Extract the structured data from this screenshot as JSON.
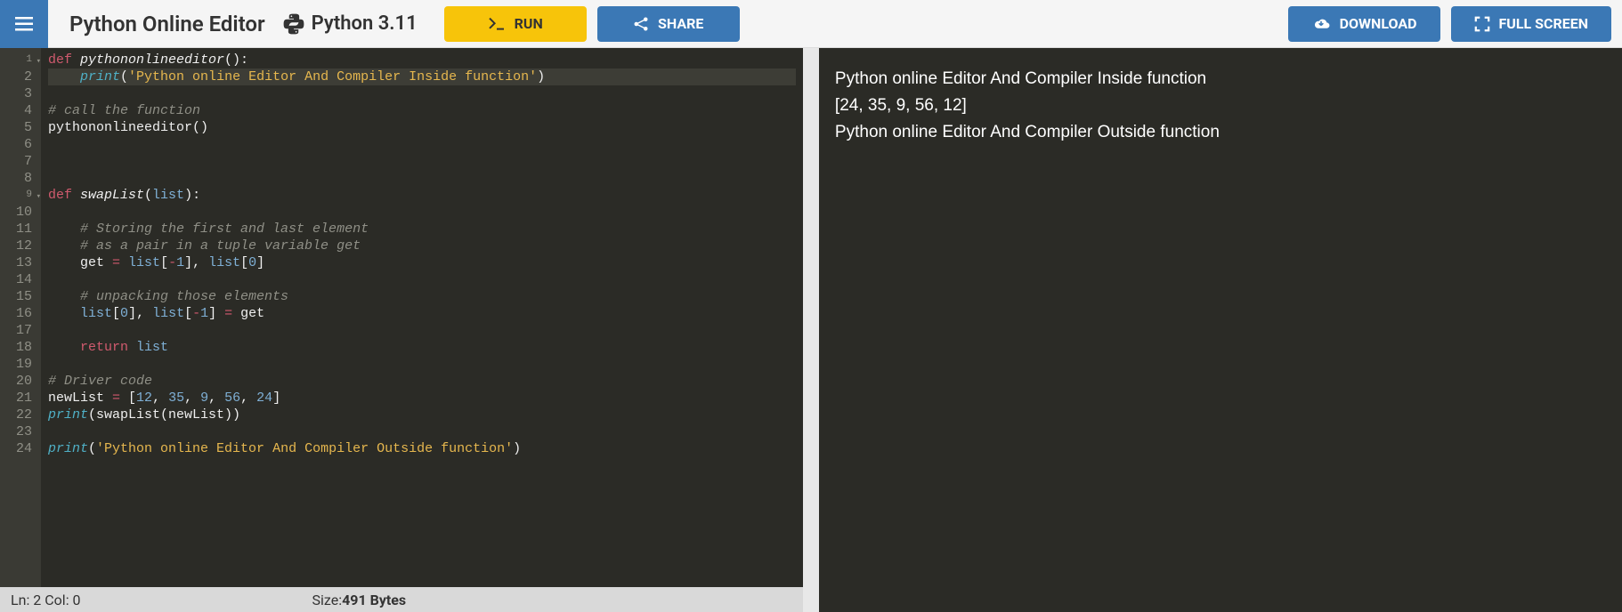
{
  "toolbar": {
    "title": "Python Online Editor",
    "language": "Python 3.11",
    "run_label": "RUN",
    "share_label": "SHARE",
    "download_label": "DOWNLOAD",
    "fullscreen_label": "FULL SCREEN"
  },
  "editor": {
    "line_numbers": [
      "1",
      "2",
      "3",
      "4",
      "5",
      "6",
      "7",
      "8",
      "9",
      "10",
      "11",
      "12",
      "13",
      "14",
      "15",
      "16",
      "17",
      "18",
      "19",
      "20",
      "21",
      "22",
      "23",
      "24"
    ],
    "fold_lines": [
      1,
      9
    ],
    "active_line": 2,
    "lines": [
      [
        {
          "t": "def ",
          "c": "kw"
        },
        {
          "t": "pythononlineeditor",
          "c": "fn"
        },
        {
          "t": "():",
          "c": "punct"
        }
      ],
      [
        {
          "t": "    ",
          "c": "id"
        },
        {
          "t": "print",
          "c": "call"
        },
        {
          "t": "(",
          "c": "punct"
        },
        {
          "t": "'Python online Editor And Compiler Inside function'",
          "c": "str"
        },
        {
          "t": ")",
          "c": "punct"
        }
      ],
      [],
      [
        {
          "t": "# call the function",
          "c": "cm"
        }
      ],
      [
        {
          "t": "pythononlineeditor",
          "c": "id"
        },
        {
          "t": "()",
          "c": "punct"
        }
      ],
      [],
      [],
      [],
      [
        {
          "t": "def ",
          "c": "kw"
        },
        {
          "t": "swapList",
          "c": "fn"
        },
        {
          "t": "(",
          "c": "punct"
        },
        {
          "t": "list",
          "c": "builtin"
        },
        {
          "t": "):",
          "c": "punct"
        }
      ],
      [],
      [
        {
          "t": "    ",
          "c": "id"
        },
        {
          "t": "# Storing the first and last element",
          "c": "cm"
        }
      ],
      [
        {
          "t": "    ",
          "c": "id"
        },
        {
          "t": "# as a pair in a tuple variable get",
          "c": "cm"
        }
      ],
      [
        {
          "t": "    get ",
          "c": "id"
        },
        {
          "t": "=",
          "c": "op"
        },
        {
          "t": " ",
          "c": "id"
        },
        {
          "t": "list",
          "c": "builtin"
        },
        {
          "t": "[",
          "c": "punct"
        },
        {
          "t": "-",
          "c": "op"
        },
        {
          "t": "1",
          "c": "num"
        },
        {
          "t": "], ",
          "c": "punct"
        },
        {
          "t": "list",
          "c": "builtin"
        },
        {
          "t": "[",
          "c": "punct"
        },
        {
          "t": "0",
          "c": "num"
        },
        {
          "t": "]",
          "c": "punct"
        }
      ],
      [],
      [
        {
          "t": "    ",
          "c": "id"
        },
        {
          "t": "# unpacking those elements",
          "c": "cm"
        }
      ],
      [
        {
          "t": "    ",
          "c": "id"
        },
        {
          "t": "list",
          "c": "builtin"
        },
        {
          "t": "[",
          "c": "punct"
        },
        {
          "t": "0",
          "c": "num"
        },
        {
          "t": "], ",
          "c": "punct"
        },
        {
          "t": "list",
          "c": "builtin"
        },
        {
          "t": "[",
          "c": "punct"
        },
        {
          "t": "-",
          "c": "op"
        },
        {
          "t": "1",
          "c": "num"
        },
        {
          "t": "] ",
          "c": "punct"
        },
        {
          "t": "=",
          "c": "op"
        },
        {
          "t": " get",
          "c": "id"
        }
      ],
      [],
      [
        {
          "t": "    ",
          "c": "id"
        },
        {
          "t": "return ",
          "c": "kw"
        },
        {
          "t": "list",
          "c": "builtin"
        }
      ],
      [],
      [
        {
          "t": "# Driver code",
          "c": "cm"
        }
      ],
      [
        {
          "t": "newList ",
          "c": "id"
        },
        {
          "t": "=",
          "c": "op"
        },
        {
          "t": " [",
          "c": "punct"
        },
        {
          "t": "12",
          "c": "num"
        },
        {
          "t": ", ",
          "c": "punct"
        },
        {
          "t": "35",
          "c": "num"
        },
        {
          "t": ", ",
          "c": "punct"
        },
        {
          "t": "9",
          "c": "num"
        },
        {
          "t": ", ",
          "c": "punct"
        },
        {
          "t": "56",
          "c": "num"
        },
        {
          "t": ", ",
          "c": "punct"
        },
        {
          "t": "24",
          "c": "num"
        },
        {
          "t": "]",
          "c": "punct"
        }
      ],
      [
        {
          "t": "print",
          "c": "call"
        },
        {
          "t": "(",
          "c": "punct"
        },
        {
          "t": "swapList",
          "c": "id"
        },
        {
          "t": "(newList))",
          "c": "punct"
        }
      ],
      [],
      [
        {
          "t": "print",
          "c": "call"
        },
        {
          "t": "(",
          "c": "punct"
        },
        {
          "t": "'Python online Editor And Compiler Outside function'",
          "c": "str"
        },
        {
          "t": ")",
          "c": "punct"
        }
      ]
    ]
  },
  "statusbar": {
    "cursor": "Ln: 2 Col: 0",
    "size_label": "Size:",
    "size_value": "491 Bytes"
  },
  "output": {
    "lines": [
      "Python online Editor And Compiler Inside function",
      "[24, 35, 9, 56, 12]",
      "Python online Editor And Compiler Outside function"
    ]
  }
}
